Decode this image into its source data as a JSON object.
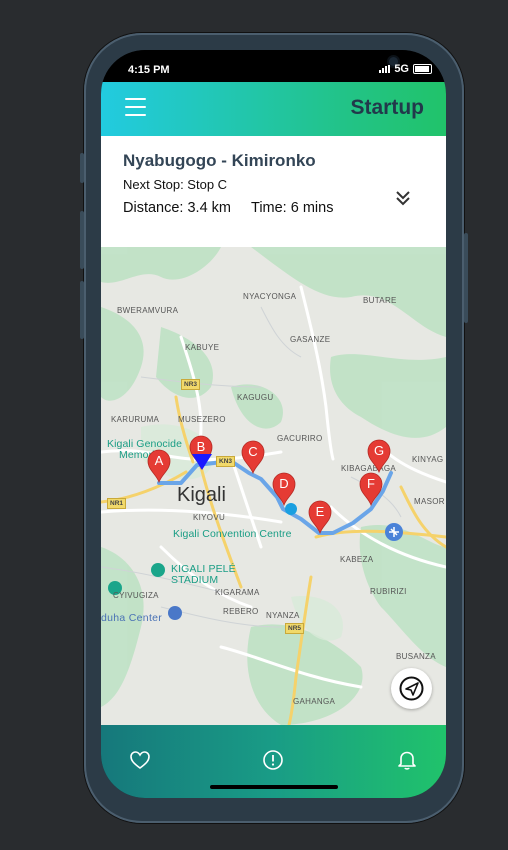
{
  "status_bar": {
    "time": "4:15 PM",
    "network": "5G"
  },
  "app": {
    "title": "Startup"
  },
  "route_card": {
    "route_name": "Nyabugogo - Kimironko",
    "next_stop": "Next Stop: Stop C",
    "distance": "Distance: 3.4 km",
    "time": "Time: 6 mins"
  },
  "map": {
    "labels": {
      "bweramvura": "BWERAMVURA",
      "nyacyonga": "NYACYONGA",
      "butare": "BUTARE",
      "kabuye": "KABUYE",
      "gasanze": "GASANZE",
      "kagugu": "KAGUGU",
      "karuruma": "KARURUMA",
      "musezero": "MUSEZERO",
      "gacuriro": "GACURIRO",
      "kibagabaga": "KIBAGABAGA",
      "kinyag": "KINYAG",
      "masor": "MASOR",
      "kigali": "Kigali",
      "kiyovu": "KIYOVU",
      "kabeza": "KABEZA",
      "rubirizi": "RUBIRIZI",
      "cyivugiza": "CYIVUGIZA",
      "kigarama": "KIGARAMA",
      "rebero": "REBERO",
      "nyanza": "NYANZA",
      "busanza": "BUSANZA",
      "gahanga": "GAHANGA"
    },
    "pois": {
      "genocide_memorial_1": "Kigali Genocide",
      "genocide_memorial_2": "Memorial",
      "convention_centre": "Kigali Convention Centre",
      "stadium_1": "KIGALI PELÉ",
      "stadium_2": "STADIUM",
      "duha_center": "duha Center"
    },
    "roads": [
      "NR3",
      "NR1",
      "NR5",
      "KN3"
    ],
    "stops": [
      "A",
      "B",
      "C",
      "D",
      "E",
      "F",
      "G"
    ]
  },
  "colors": {
    "accent_start": "#22cbe0",
    "accent_end": "#21c36a",
    "route_line": "#6aa5e8",
    "marker": "#e53b34",
    "bus_marker": "#1a1aff"
  },
  "bottom_nav": [
    "heart-icon",
    "alert-icon",
    "bell-icon"
  ]
}
